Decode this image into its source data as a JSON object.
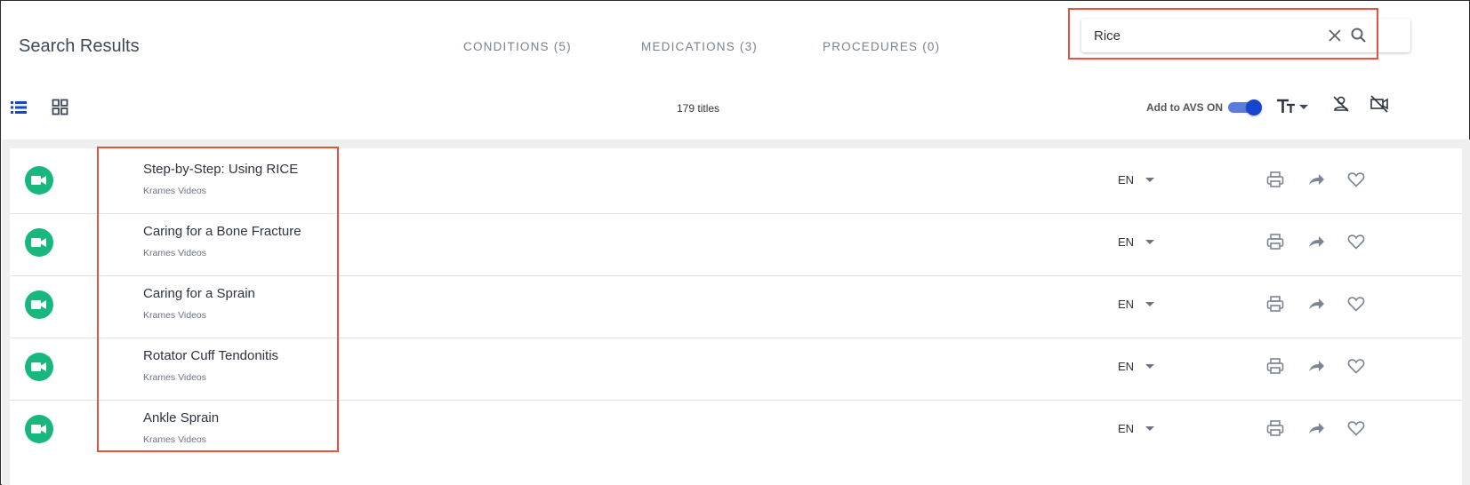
{
  "header": {
    "title": "Search Results",
    "tabs": [
      {
        "label": "CONDITIONS (5)"
      },
      {
        "label": "MEDICATIONS (3)"
      },
      {
        "label": "PROCEDURES (0)"
      }
    ]
  },
  "search": {
    "value": "Rice",
    "clear_icon": "close-icon",
    "search_icon": "search-icon"
  },
  "toolbar": {
    "list_view_icon": "list-view-icon",
    "grid_view_icon": "grid-view-icon",
    "titles_count": "179 titles",
    "avs_label": "Add to AVS ON",
    "avs_on": true,
    "font_size_icon": "text-size-icon",
    "person_off_icon": "person-off-icon",
    "video_off_icon": "video-off-icon"
  },
  "colors": {
    "accent": "#1744cf",
    "video_badge": "#17b77e",
    "annotation": "#e8513a"
  },
  "results": [
    {
      "title": "Step-by-Step: Using RICE",
      "source": "Krames Videos",
      "lang": "EN"
    },
    {
      "title": "Caring for a Bone Fracture",
      "source": "Krames Videos",
      "lang": "EN"
    },
    {
      "title": "Caring for a Sprain",
      "source": "Krames Videos",
      "lang": "EN"
    },
    {
      "title": "Rotator Cuff Tendonitis",
      "source": "Krames Videos",
      "lang": "EN"
    },
    {
      "title": "Ankle Sprain",
      "source": "Krames Videos",
      "lang": "EN"
    }
  ]
}
